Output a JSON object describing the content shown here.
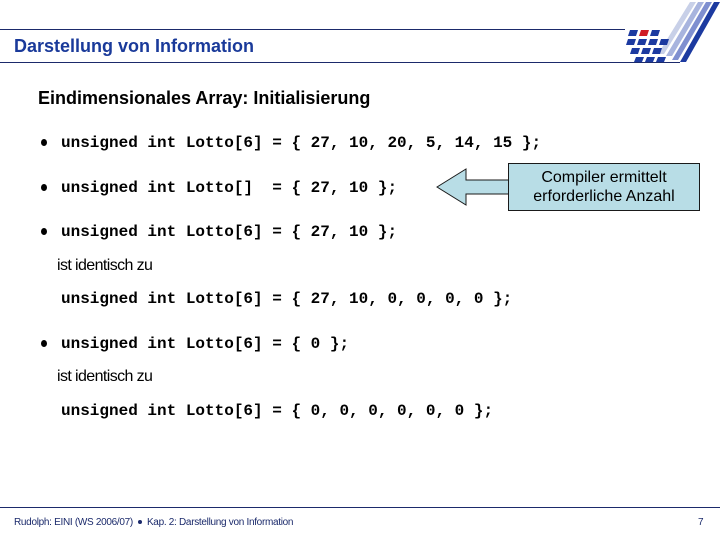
{
  "header": {
    "title": "Darstellung von Information",
    "logo": "university-logo",
    "line_color": "#1b2a6b",
    "title_color": "#1a3a9a"
  },
  "slide": {
    "subtitle": "Eindimensionales Array: Initialisierung",
    "items": [
      {
        "bullet": true,
        "code": "unsigned int Lotto[6] = { 27, 10, 20, 5, 14, 15 };"
      },
      {
        "bullet": true,
        "code": "unsigned int Lotto[]  = { 27, 10 };"
      },
      {
        "bullet": true,
        "code": "unsigned int Lotto[6] = { 27, 10 };"
      },
      {
        "bullet": false,
        "text": "ist identisch zu"
      },
      {
        "bullet": false,
        "code": "unsigned int Lotto[6] = { 27, 10, 0, 0, 0, 0 };"
      },
      {
        "bullet": true,
        "code": "unsigned int Lotto[6] = { 0 };"
      },
      {
        "bullet": false,
        "text": "ist identisch zu"
      },
      {
        "bullet": false,
        "code": "unsigned int Lotto[6] = { 0, 0, 0, 0, 0, 0 };"
      }
    ],
    "callout": {
      "line1": "Compiler ermittelt",
      "line2": "erforderliche Anzahl",
      "fill": "#b8dde6"
    }
  },
  "footer": {
    "left_part1": "Rudolph: EINI (WS 2006/07)",
    "left_part2": "Kap. 2: Darstellung von Information",
    "page_number": "7"
  }
}
